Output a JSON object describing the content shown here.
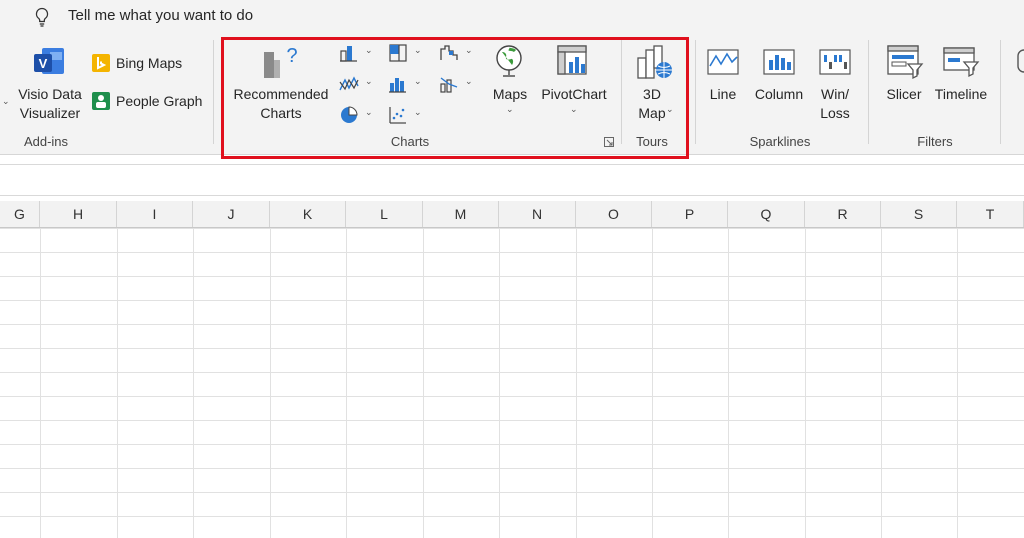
{
  "tell_me": {
    "text": "Tell me what you want to do"
  },
  "addins": {
    "group_label": "Add-ins",
    "visio_line1": "Visio Data",
    "visio_line2": "Visualizer",
    "bing_maps": "Bing Maps",
    "people_graph": "People Graph"
  },
  "charts": {
    "group_label": "Charts",
    "recommended_line1": "Recommended",
    "recommended_line2": "Charts",
    "maps": "Maps",
    "pivotchart": "PivotChart"
  },
  "tours": {
    "group_label": "Tours",
    "map3d_line1": "3D",
    "map3d_line2": "Map"
  },
  "sparklines": {
    "group_label": "Sparklines",
    "line": "Line",
    "column": "Column",
    "winloss_line1": "Win/",
    "winloss_line2": "Loss"
  },
  "filters": {
    "group_label": "Filters",
    "slicer": "Slicer",
    "timeline": "Timeline"
  },
  "columns": [
    "G",
    "H",
    "I",
    "J",
    "K",
    "L",
    "M",
    "N",
    "O",
    "P",
    "Q",
    "R",
    "S",
    "T"
  ],
  "colors": {
    "highlight": "#e0101d",
    "accent_blue": "#2b79d0",
    "ribbon_bg": "#f3f3f3"
  }
}
